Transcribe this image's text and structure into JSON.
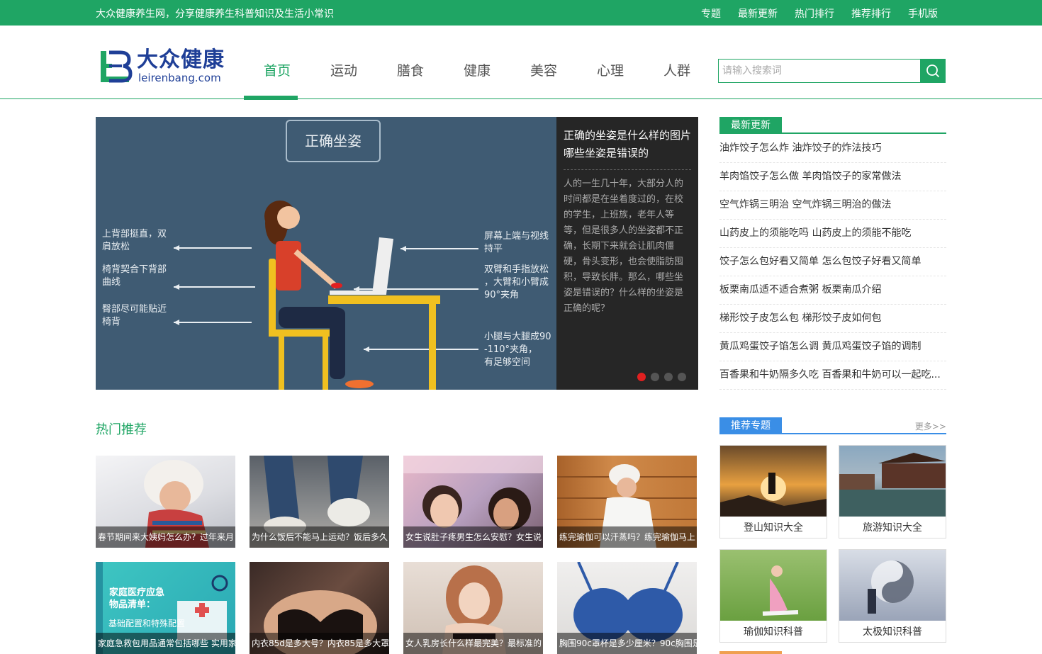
{
  "topbar": {
    "tagline": "大众健康养生网，分享健康养生科普知识及生活小常识",
    "links": [
      "专题",
      "最新更新",
      "热门排行",
      "推荐排行",
      "手机版"
    ]
  },
  "logo": {
    "cn": "大众健康",
    "en": "leirenbang.com"
  },
  "nav": {
    "items": [
      "首页",
      "运动",
      "膳食",
      "健康",
      "美容",
      "心理",
      "人群"
    ],
    "active_index": 0
  },
  "search": {
    "placeholder": "请输入搜索词"
  },
  "slider": {
    "title": "正确的坐姿是什么样的图片 哪些坐姿是错误的",
    "description": "人的一生几十年，大部分人的时间都是在坐着度过的，在校的学生，上班族，老年人等等，但是很多人的坐姿都不正确，长期下来就会让肌肉僵硬，骨头变形，也会使脂肪囤积，导致长胖。那么，哪些坐姿是错误的？什么样的坐姿是正确的呢？",
    "dot_count": 4,
    "active_dot": 0,
    "illustration": {
      "heading": "正确坐姿",
      "labels_left": [
        "上背部挺直，双\n肩放松",
        "椅背契合下背部\n曲线",
        "臀部尽可能贴近\n椅背"
      ],
      "labels_right": [
        "屏幕上端与视线\n持平",
        "双臂和手指放松\n，大臂和小臂成\n90°夹角",
        "小腿与大腿成90\n-110°夹角，\n有足够空间"
      ]
    }
  },
  "latest": {
    "heading": "最新更新",
    "items": [
      "油炸饺子怎么炸 油炸饺子的炸法技巧",
      "羊肉馅饺子怎么做 羊肉馅饺子的家常做法",
      "空气炸锅三明治 空气炸锅三明治的做法",
      "山药皮上的须能吃吗 山药皮上的须能不能吃",
      "饺子怎么包好看又简单 怎么包饺子好看又简单",
      "板栗南瓜适不适合煮粥 板栗南瓜介绍",
      "梯形饺子皮怎么包 梯形饺子皮如何包",
      "黄瓜鸡蛋饺子馅怎么调 黄瓜鸡蛋饺子馅的调制",
      "百香果和牛奶隔多久吃 百香果和牛奶可以一起吃..."
    ]
  },
  "hot": {
    "heading": "热门推荐",
    "cards": [
      {
        "caption": "春节期间来大姨妈怎么办？过年来月",
        "icon": "winter-girl-photo"
      },
      {
        "caption": "为什么饭后不能马上运动？饭后多久",
        "icon": "running-feet-photo"
      },
      {
        "caption": "女生说肚子疼男生怎么安慰？女生说",
        "icon": "couple-photo"
      },
      {
        "caption": "练完瑜伽可以汗蒸吗？练完瑜伽马上",
        "icon": "sauna-photo"
      },
      {
        "caption": "家庭急救包用品通常包括哪些 实用家",
        "icon": "first-aid-photo",
        "image_text": [
          "家庭医疗应急",
          "物品清单：",
          "基础配置和特殊配置"
        ]
      },
      {
        "caption": "内衣85d是多大号？内衣85是多大罩",
        "icon": "lingerie-photo"
      },
      {
        "caption": "女人乳房长什么样最完美？最标准的",
        "icon": "woman-portrait-photo"
      },
      {
        "caption": "胸围90c罩杯是多少厘米？90c胸围是",
        "icon": "blue-bra-photo"
      }
    ]
  },
  "topics": {
    "heading": "推荐专题",
    "more": "更多>>",
    "items": [
      {
        "label": "登山知识大全",
        "icon": "mountain-sunset-photo"
      },
      {
        "label": "旅游知识大全",
        "icon": "water-town-photo"
      },
      {
        "label": "瑜伽知识科普",
        "icon": "yoga-photo"
      },
      {
        "label": "太极知识科普",
        "icon": "taichi-photo"
      }
    ]
  },
  "colors": {
    "brand": "#1fa564",
    "accent_blue": "#3a8ee6",
    "dot_active": "#e02020",
    "logo_blue": "#1f3f97"
  }
}
